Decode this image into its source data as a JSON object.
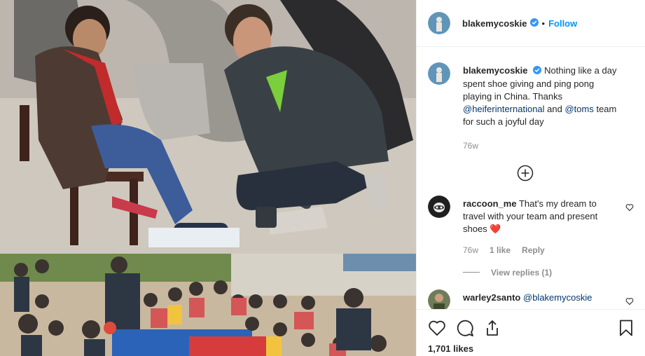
{
  "post": {
    "username": "blakemycoskie",
    "follow_label": "Follow",
    "separator": "•",
    "caption": {
      "username": "blakemycoskie",
      "text_before": "Nothing like a day spent shoe giving and ping pong playing in China. Thanks ",
      "mention1": "@heiferinternational",
      "text_mid": " and ",
      "mention2": "@toms",
      "text_after": " team for such a joyful day",
      "time": "76w"
    },
    "comments": [
      {
        "username": "raccoon_me",
        "text": "That's my dream to travel with your team and present shoes",
        "emoji": "❤️",
        "time": "76w",
        "likes": "1 like",
        "reply_label": "Reply",
        "view_replies": "View replies (1)"
      },
      {
        "username": "warley2santo",
        "mention": "@blakemycoskie"
      }
    ],
    "likes_count": "1,701 likes"
  },
  "colors": {
    "link": "#0095f6",
    "mention": "#00376b",
    "muted": "#8e8e8e",
    "heart": "#ed4956"
  },
  "icons": [
    "verified-badge-icon",
    "add-comment-icon",
    "heart-icon",
    "comment-icon",
    "share-icon",
    "save-icon"
  ]
}
